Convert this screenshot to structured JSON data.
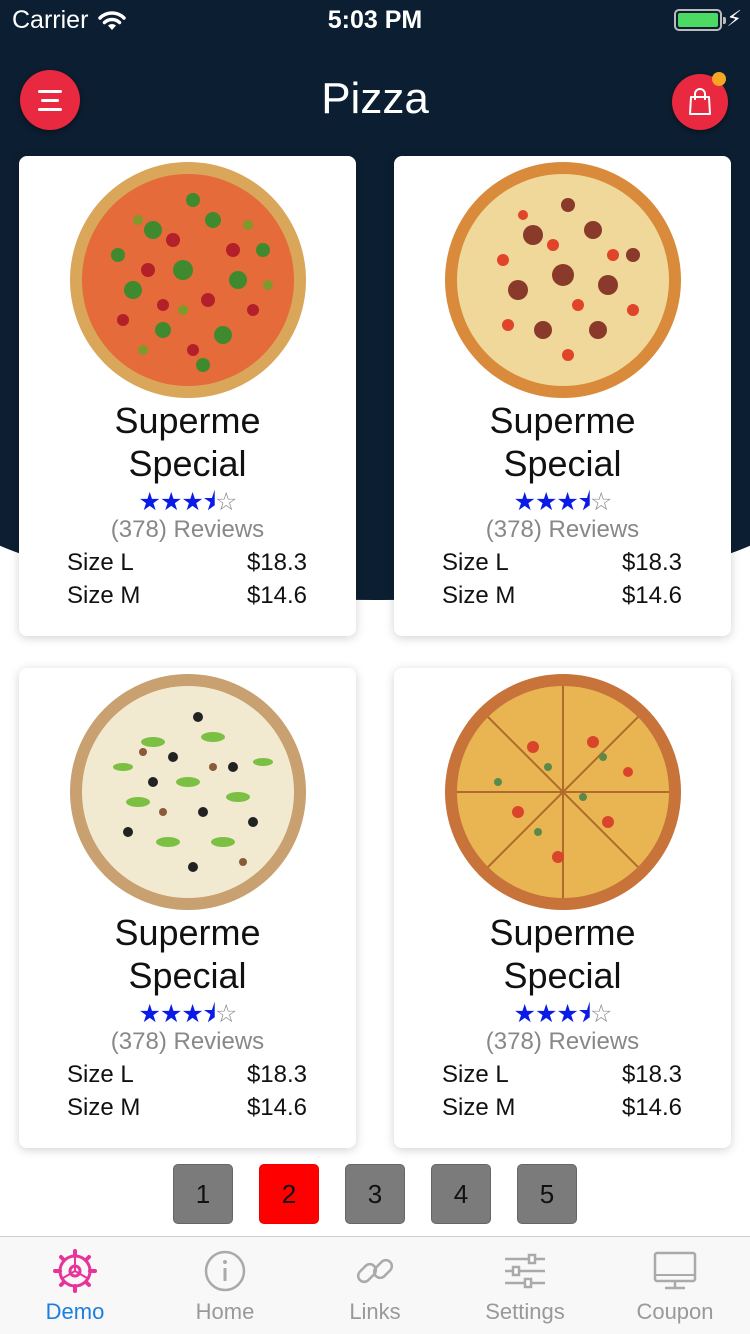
{
  "status_bar": {
    "carrier": "Carrier",
    "time": "5:03 PM",
    "battery_level": 1.0
  },
  "header": {
    "title": "Pizza",
    "menu_icon": "hamburger-menu-icon",
    "cart_icon": "shopping-bag-icon",
    "accent_color": "#e8293f",
    "background_color": "#0c1e31"
  },
  "products": [
    {
      "name_line1": "Superme",
      "name_line2": "Special",
      "rating": 3.5,
      "rating_max": 5,
      "reviews": "(378) Reviews",
      "size_l_label": "Size L",
      "size_l_price": "$18.3",
      "size_m_label": "Size M",
      "size_m_price": "$14.6"
    },
    {
      "name_line1": "Superme",
      "name_line2": "Special",
      "rating": 3.5,
      "rating_max": 5,
      "reviews": "(378) Reviews",
      "size_l_label": "Size L",
      "size_l_price": "$18.3",
      "size_m_label": "Size M",
      "size_m_price": "$14.6"
    },
    {
      "name_line1": "Superme",
      "name_line2": "Special",
      "rating": 3.5,
      "rating_max": 5,
      "reviews": "(378) Reviews",
      "size_l_label": "Size L",
      "size_l_price": "$18.3",
      "size_m_label": "Size M",
      "size_m_price": "$14.6"
    },
    {
      "name_line1": "Superme",
      "name_line2": "Special",
      "rating": 3.5,
      "rating_max": 5,
      "reviews": "(378) Reviews",
      "size_l_label": "Size L",
      "size_l_price": "$18.3",
      "size_m_label": "Size M",
      "size_m_price": "$14.6"
    }
  ],
  "pagination": {
    "pages": [
      "1",
      "2",
      "3",
      "4",
      "5"
    ],
    "current": "2",
    "active_color": "#ff0000"
  },
  "tab_bar": {
    "tabs": [
      {
        "label": "Demo",
        "icon": "gear-icon",
        "active": true
      },
      {
        "label": "Home",
        "icon": "info-icon",
        "active": false
      },
      {
        "label": "Links",
        "icon": "link-icon",
        "active": false
      },
      {
        "label": "Settings",
        "icon": "sliders-icon",
        "active": false
      },
      {
        "label": "Coupon",
        "icon": "monitor-icon",
        "active": false
      }
    ],
    "active_color": "#1a7fe0"
  }
}
